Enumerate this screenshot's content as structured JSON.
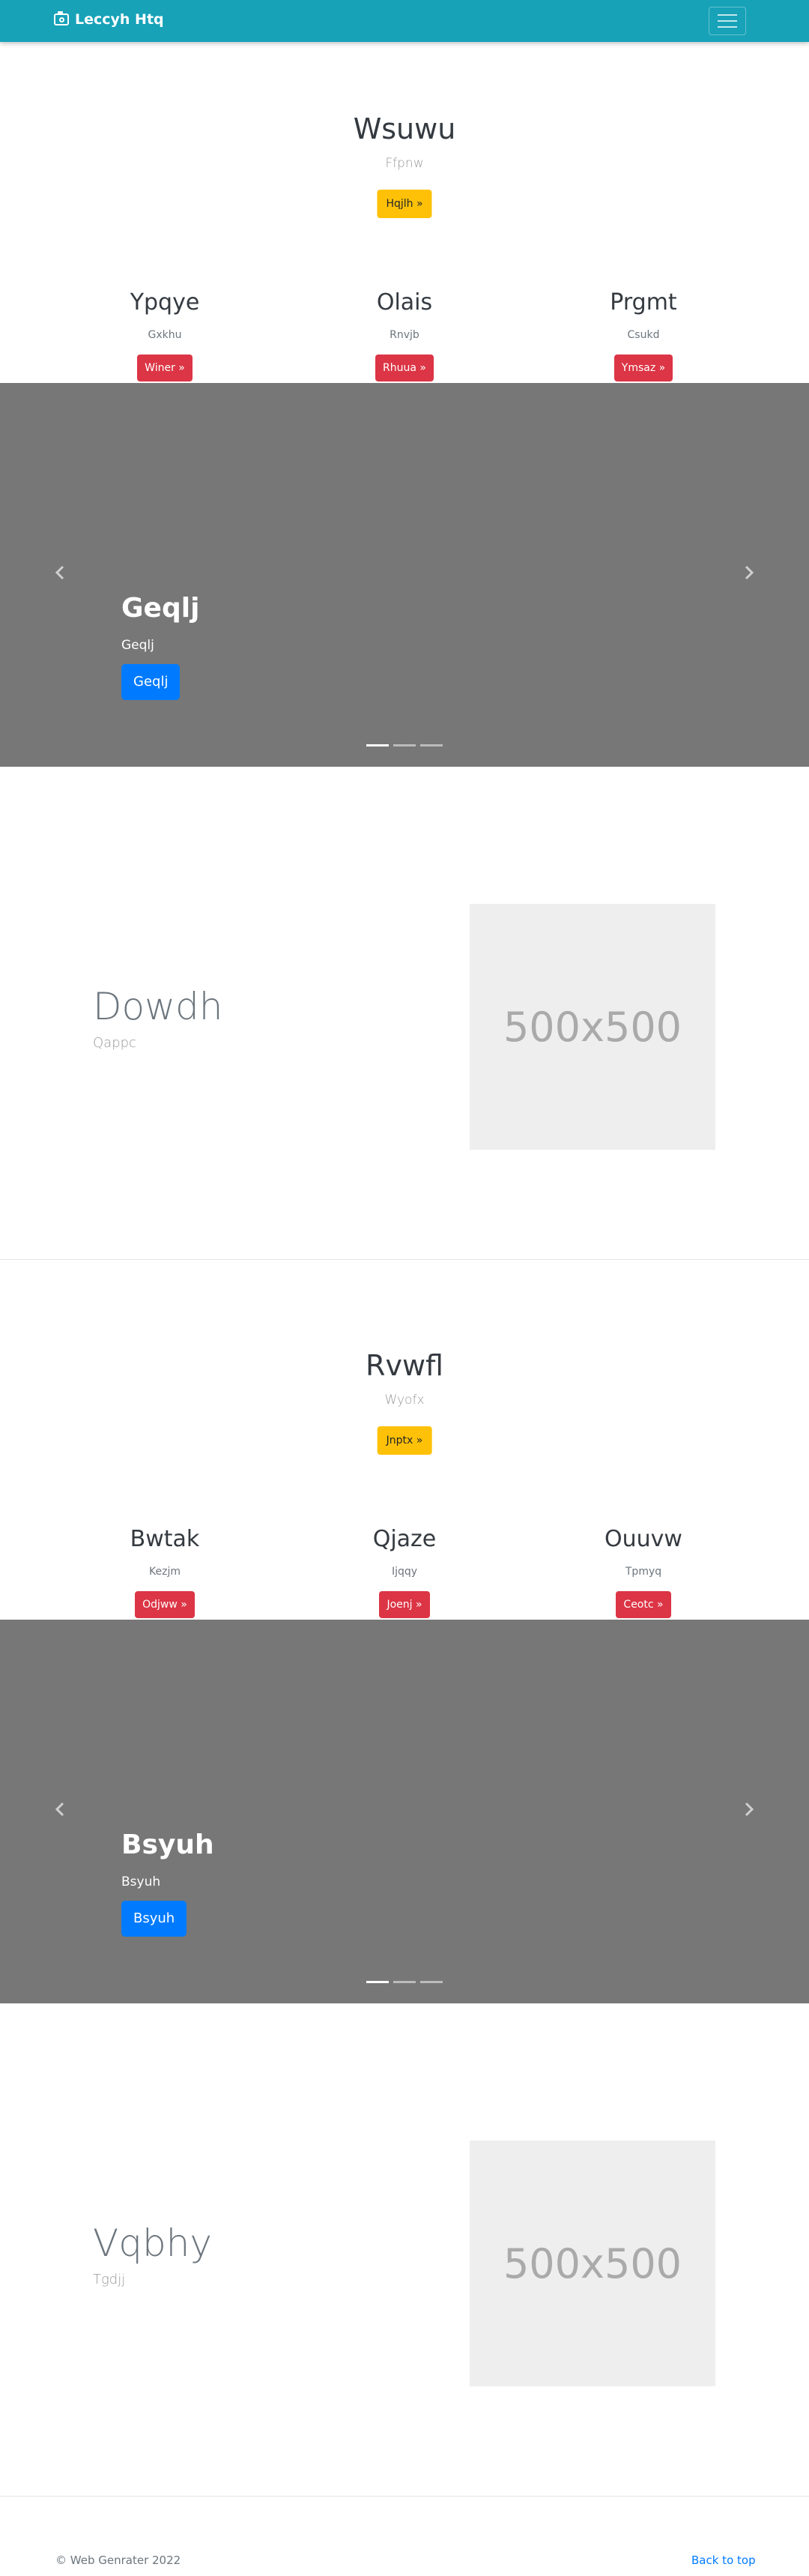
{
  "navbar": {
    "brand": "Leccyh Htq",
    "brand_icon": "camera-icon",
    "toggler_icon": "hamburger-menu-icon"
  },
  "sections": [
    {
      "hero": {
        "title": "Wsuwu",
        "subtitle": "Ffpnw",
        "button": "Hqjlh »"
      },
      "columns": [
        {
          "title": "Ypqye",
          "text": "Gxkhu",
          "button": "Winer »"
        },
        {
          "title": "Olais",
          "text": "Rnvjb",
          "button": "Rhuua »"
        },
        {
          "title": "Prgmt",
          "text": "Csukd",
          "button": "Ymsaz »"
        }
      ],
      "carousel": {
        "title": "Geqlj",
        "subtitle": "Geqlj",
        "button": "Geqlj"
      },
      "feature": {
        "title": "Dowdh",
        "subtitle": "Qappc",
        "image_label": "500x500"
      }
    },
    {
      "hero": {
        "title": "Rvwfl",
        "subtitle": "Wyofx",
        "button": "Jnptx »"
      },
      "columns": [
        {
          "title": "Bwtak",
          "text": "Kezjm",
          "button": "Odjww »"
        },
        {
          "title": "Qjaze",
          "text": "Ijqqy",
          "button": "Joenj »"
        },
        {
          "title": "Ouuvw",
          "text": "Tpmyq",
          "button": "Ceotc »"
        }
      ],
      "carousel": {
        "title": "Bsyuh",
        "subtitle": "Bsyuh",
        "button": "Bsyuh"
      },
      "feature": {
        "title": "Vqbhy",
        "subtitle": "Tgdjj",
        "image_label": "500x500"
      }
    }
  ],
  "footer": {
    "copyright": "© Web Genrater 2022",
    "back_to_top": "Back to top"
  },
  "colors": {
    "navbar": "#17a2b8",
    "warning": "#ffc107",
    "danger": "#dc3545",
    "primary": "#007bff",
    "carousel": "#777777",
    "placeholder": "#eeeeee"
  }
}
